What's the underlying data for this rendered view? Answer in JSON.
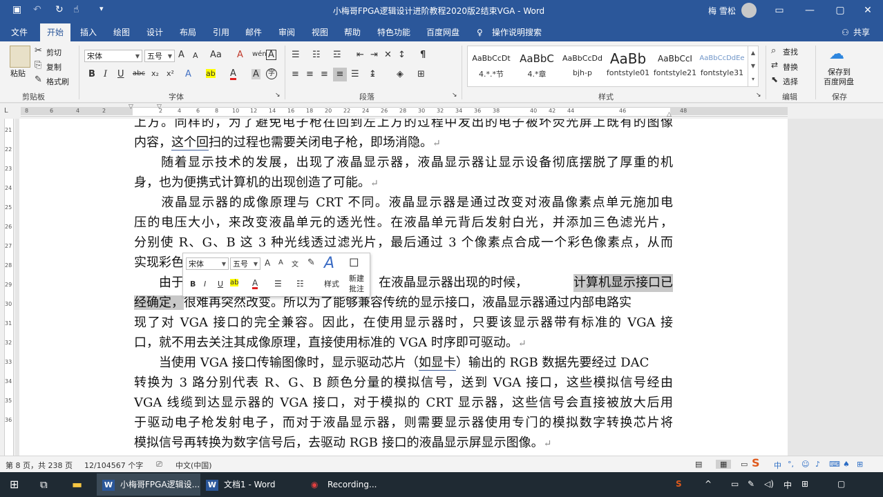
{
  "titlebar": {
    "title": "小梅哥FPGA逻辑设计进阶教程2020版2结束VGA  -  Word",
    "user": "梅 雪松",
    "save_icon": "save-icon",
    "undo": "↶",
    "redo": "↻",
    "touch": "☝",
    "customize": "▾",
    "ribbon_opts": "▭",
    "minimize": "—",
    "maximize": "▢",
    "close": "✕"
  },
  "tabs": [
    "文件",
    "开始",
    "插入",
    "绘图",
    "设计",
    "布局",
    "引用",
    "邮件",
    "审阅",
    "视图",
    "帮助",
    "特色功能",
    "百度网盘",
    "操作说明搜索"
  ],
  "share": "共享",
  "ribbon": {
    "clipboard": {
      "paste": "粘贴",
      "cut": "剪切",
      "copy": "复制",
      "format_painter": "格式刷",
      "group": "剪贴板"
    },
    "font": {
      "name": "宋体",
      "size": "五号",
      "group": "字体",
      "bold": "B",
      "italic": "I",
      "underline": "U",
      "strike": "abc",
      "sub": "x₂",
      "sup": "x²",
      "grow": "A",
      "shrink": "A",
      "case": "Aa",
      "phonetic": "wén",
      "border_a": "A",
      "text_effect": "A",
      "highlight": "ab",
      "color": "A",
      "clear_fmt": "A",
      "enclose": "字"
    },
    "paragraph": {
      "group": "段落"
    },
    "styles": {
      "group": "样式",
      "items": [
        {
          "preview": "AaBbCcDt",
          "name": "4.*.*节"
        },
        {
          "preview": "AaBbC",
          "name": "4.*章"
        },
        {
          "preview": "AaBbCcDd",
          "name": "bjh-p"
        },
        {
          "preview": "AaBb",
          "name": "fontstyle01"
        },
        {
          "preview": "AaBbCcI",
          "name": "fontstyle21"
        },
        {
          "preview": "AaBbCcDdEe",
          "name": "fontstyle31"
        }
      ]
    },
    "editing": {
      "find": "查找",
      "replace": "替换",
      "select": "选择",
      "group": "编辑"
    },
    "save": {
      "label1": "保存到",
      "label2": "百度网盘",
      "group": "保存"
    }
  },
  "ruler": {
    "h_numbers": [
      "8",
      "6",
      "4",
      "2",
      "",
      "2",
      "4",
      "6",
      "8",
      "10",
      "12",
      "14",
      "16",
      "18",
      "20",
      "22",
      "24",
      "26",
      "28",
      "30",
      "32",
      "34",
      "36",
      "38",
      "",
      "40",
      "42",
      "44",
      "46",
      "48"
    ],
    "v_numbers": [
      "21",
      "22",
      "23",
      "24",
      "25",
      "26",
      "27",
      "28",
      "29",
      "30",
      "31",
      "32",
      "33",
      "34",
      "35",
      "36"
    ]
  },
  "document": {
    "lines": [
      {
        "text": "上方。同样的，为了避免电子枪在回到左上方的过程中发出的电子被坏荧光屏上既有的图像"
      },
      {
        "before": "内容，",
        "underlined": "这个回",
        "after": "扫的过程也需要关闭电子枪，即场消隐。"
      },
      {
        "text": "　　随着显示技术的发展，出现了液晶显示器，液晶显示器让显示设备彻底摆脱了厚重的机"
      },
      {
        "text": "身，也为便携式计算机的出现创造了可能。"
      },
      {
        "text": "　　液晶显示器的成像原理与 CRT 不同。液晶显示器是通过改变对液晶像素点单元施加电"
      },
      {
        "text": "压的电压大小，来改变液晶单元的透光性。在液晶单元背后发射白光，并添加三色滤光片，"
      },
      {
        "text": "分别使 R、G、B 这 3 种光线透过滤光片，最后通过 3 个像素点合成一个彩色像素点，从而"
      },
      {
        "text": "实现彩色"
      },
      {
        "start": "　　由于",
        "middle": "生，在液晶显示器出现的时候，",
        "highlight": "计算机显示接口已"
      },
      {
        "highlight": "经确定，",
        "after": "很难再突然改变。所以为了能够兼容传统的显示接口，液晶显示器通过内部电路实"
      },
      {
        "text": "现了对 VGA 接口的完全兼容。因此，在使用显示器时，只要该显示器带有标准的 VGA 接"
      },
      {
        "text": "口，就不用去关注其成像原理，直接使用标准的 VGA 时序即可驱动。"
      },
      {
        "before": "　　当使用 VGA 接口传输图像时，显示驱动芯片（",
        "underlined": "如显卡",
        "after": "）输出的 RGB 数据先要经过 DAC"
      },
      {
        "text": "转换为 3 路分别代表 R、G、B 颜色分量的模拟信号，送到 VGA 接口，这些模拟信号经由"
      },
      {
        "text": "VGA 线缆到达显示器的 VGA 接口，对于模拟的 CRT 显示器，这些信号会直接被放大后用"
      },
      {
        "text": "于驱动电子枪发射电子，而对于液晶显示器，则需要显示器使用专门的模拟数字转换芯片将"
      },
      {
        "text": "模拟信号再转换为数字信号后，去驱动 RGB 接口的液晶显示屏显示图像。"
      }
    ],
    "para_mark": "↵"
  },
  "mini_toolbar": {
    "font": "宋体",
    "size": "五号",
    "styles": "样式",
    "new_comment_1": "新建",
    "new_comment_2": "批注"
  },
  "status": {
    "page": "第 8 页，共 238 页",
    "words": "12/104567 个字",
    "lang": "中文(中国)"
  },
  "taskbar": {
    "apps": [
      {
        "label": "小梅哥FPGA逻辑设..."
      },
      {
        "label": "文档1 - Word"
      },
      {
        "label": "Recording..."
      }
    ],
    "ime": "中"
  }
}
